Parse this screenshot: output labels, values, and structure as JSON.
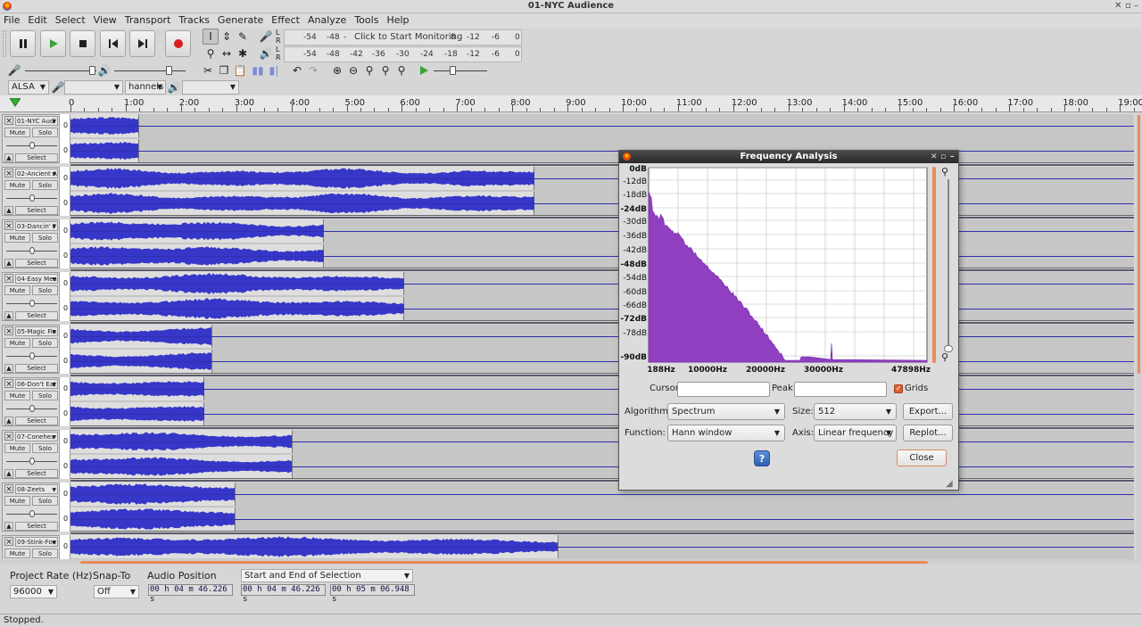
{
  "window": {
    "title": "01-NYC Audience"
  },
  "menu": [
    "File",
    "Edit",
    "Select",
    "View",
    "Transport",
    "Tracks",
    "Generate",
    "Effect",
    "Analyze",
    "Tools",
    "Help"
  ],
  "meters": {
    "record_scale": [
      "-54",
      "-48",
      "-",
      "Click to Start Monitoring",
      "8",
      "-12",
      "-6",
      "0"
    ],
    "play_scale": [
      "-54",
      "-48",
      "-42",
      "-36",
      "-30",
      "-24",
      "-18",
      "-12",
      "-6",
      "0"
    ],
    "channels": {
      "left": "L",
      "right": "R"
    }
  },
  "device": {
    "host": "ALSA",
    "channels_label": "hannels"
  },
  "ruler": [
    "0",
    "1:00",
    "2:00",
    "3:00",
    "4:00",
    "5:00",
    "6:00",
    "7:00",
    "8:00",
    "9:00",
    "10:00",
    "11:00",
    "12:00",
    "13:00",
    "14:00",
    "15:00",
    "16:00",
    "17:00",
    "18:00",
    "19:00"
  ],
  "tracks": [
    {
      "name": "01-NYC Audi",
      "end": 0.065
    },
    {
      "name": "02-Ancient A",
      "end": 0.436
    },
    {
      "name": "03-Dancin' F",
      "end": 0.238
    },
    {
      "name": "04-Easy Mea",
      "end": 0.314
    },
    {
      "name": "05-Magic Fin",
      "end": 0.133
    },
    {
      "name": "06-Don't Eat",
      "end": 0.126
    },
    {
      "name": "07-Conehea",
      "end": 0.209
    },
    {
      "name": "08-Zeets",
      "end": 0.155
    },
    {
      "name": "09-Stink-Foo",
      "end": 0.459
    }
  ],
  "track_labels": {
    "mute": "Mute",
    "solo": "Solo",
    "select": "Select",
    "zero": "0"
  },
  "project": {
    "rate_label": "Project Rate (Hz)",
    "rate_value": "96000",
    "snap_label": "Snap-To",
    "snap_value": "Off",
    "audio_position_label": "Audio Position",
    "audio_position": "00 h 04 m 46.226 s",
    "selection_mode": "Start and End of Selection",
    "sel_start": "00 h 04 m 46.226 s",
    "sel_end": "00 h 05 m 06.948 s"
  },
  "status": "Stopped.",
  "dialog": {
    "title": "Frequency Analysis",
    "db_labels": [
      "0dB",
      "-12dB",
      "-18dB",
      "-24dB",
      "-30dB",
      "-36dB",
      "-42dB",
      "-48dB",
      "-54dB",
      "-60dB",
      "-66dB",
      "-72dB",
      "-78dB",
      "-90dB"
    ],
    "hz_labels": [
      "188Hz",
      "10000Hz",
      "20000Hz",
      "30000Hz",
      "47898Hz"
    ],
    "cursor_label": "Cursor:",
    "peak_label": "Peak:",
    "grids_label": "Grids",
    "algorithm_label": "Algorithm:",
    "algorithm_value": "Spectrum",
    "size_label": "Size:",
    "size_value": "512",
    "export_label": "Export...",
    "function_label": "Function:",
    "function_value": "Hann window",
    "axis_label": "Axis:",
    "axis_value": "Linear frequency",
    "replot_label": "Replot...",
    "help_label": "?",
    "close_label": "Close"
  },
  "colors": {
    "waveform": "#3636c8",
    "spectrum": "#8f3fbf",
    "accent": "#e98a5a"
  }
}
